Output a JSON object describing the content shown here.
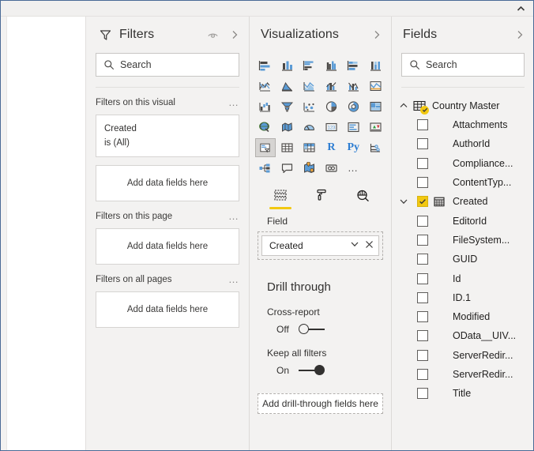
{
  "topbar": {
    "collapse_icon": "chevron-up-icon"
  },
  "filters": {
    "title": "Filters",
    "funnel_icon": "funnel-icon",
    "eye_icon": "eye-icon",
    "expand_icon": "chevron-right-icon",
    "search_placeholder": "Search",
    "search_icon": "search-icon",
    "groups": [
      {
        "title": "Filters on this visual",
        "menu": "…",
        "cards": [
          {
            "field": "Created",
            "condition": "is (All)"
          }
        ],
        "dropzone": "Add data fields here"
      },
      {
        "title": "Filters on this page",
        "menu": "…",
        "cards": [],
        "dropzone": "Add data fields here"
      },
      {
        "title": "Filters on all pages",
        "menu": "…",
        "cards": [],
        "dropzone": "Add data fields here"
      }
    ]
  },
  "visualizations": {
    "title": "Visualizations",
    "expand_icon": "chevron-right-icon",
    "icons": [
      "stacked-bar-chart-icon",
      "stacked-column-chart-icon",
      "clustered-bar-chart-icon",
      "clustered-column-chart-icon",
      "100-stacked-bar-chart-icon",
      "100-stacked-column-chart-icon",
      "line-chart-icon",
      "area-chart-icon",
      "stacked-area-chart-icon",
      "line-stacked-column-chart-icon",
      "line-clustered-column-chart-icon",
      "ribbon-chart-icon",
      "waterfall-chart-icon",
      "funnel-chart-icon",
      "scatter-chart-icon",
      "pie-chart-icon",
      "donut-chart-icon",
      "treemap-icon",
      "map-icon",
      "filled-map-icon",
      "gauge-icon",
      "card-icon",
      "multi-row-card-icon",
      "kpi-icon",
      "slicer-icon",
      "table-icon",
      "matrix-icon",
      "r-script-visual-icon",
      "python-visual-icon",
      "key-influencers-icon",
      "decomposition-tree-icon",
      "q-and-a-icon",
      "arcgis-maps-icon",
      "paginated-report-icon",
      "more-options-icon"
    ],
    "selected_icon": "slicer-icon",
    "r_label": "R",
    "py_label": "Py",
    "more_label": "…",
    "tabs": [
      {
        "label": "Field",
        "icon": "fields-pane-icon",
        "active": true
      },
      {
        "label": "Format",
        "icon": "paint-roller-icon",
        "active": false
      },
      {
        "label": "Analytics",
        "icon": "magnifier-chart-icon",
        "active": false
      }
    ],
    "section_label": "Field",
    "well_chip": {
      "label": "Created",
      "chevron_icon": "chevron-down-icon",
      "remove_icon": "close-icon"
    }
  },
  "drill_through": {
    "title": "Drill through",
    "cross_report": {
      "label": "Cross-report",
      "state": "Off",
      "on": false
    },
    "keep_all_filters": {
      "label": "Keep all filters",
      "state": "On",
      "on": true
    },
    "dropzone": "Add drill-through fields here"
  },
  "fields": {
    "title": "Fields",
    "expand_icon": "chevron-right-icon",
    "search_placeholder": "Search",
    "search_icon": "search-icon",
    "table": {
      "name": "Country Master",
      "icon": "table-icon",
      "badge_icon": "check-icon",
      "collapse_icon": "chevron-up-icon",
      "expanded": true
    },
    "items": [
      {
        "label": "Attachments",
        "checked": false,
        "icon": null,
        "chevron": false
      },
      {
        "label": "AuthorId",
        "checked": false,
        "icon": null,
        "chevron": false
      },
      {
        "label": "Compliance...",
        "checked": false,
        "icon": null,
        "chevron": false
      },
      {
        "label": "ContentTyp...",
        "checked": false,
        "icon": null,
        "chevron": false
      },
      {
        "label": "Created",
        "checked": true,
        "icon": "calendar-icon",
        "chevron": true
      },
      {
        "label": "EditorId",
        "checked": false,
        "icon": null,
        "chevron": false
      },
      {
        "label": "FileSystem...",
        "checked": false,
        "icon": null,
        "chevron": false
      },
      {
        "label": "GUID",
        "checked": false,
        "icon": null,
        "chevron": false
      },
      {
        "label": "Id",
        "checked": false,
        "icon": null,
        "chevron": false
      },
      {
        "label": "ID.1",
        "checked": false,
        "icon": null,
        "chevron": false
      },
      {
        "label": "Modified",
        "checked": false,
        "icon": null,
        "chevron": false
      },
      {
        "label": "OData__UIV...",
        "checked": false,
        "icon": null,
        "chevron": false
      },
      {
        "label": "ServerRedir...",
        "checked": false,
        "icon": null,
        "chevron": false
      },
      {
        "label": "ServerRedir...",
        "checked": false,
        "icon": null,
        "chevron": false
      },
      {
        "label": "Title",
        "checked": false,
        "icon": null,
        "chevron": false
      }
    ]
  },
  "colors": {
    "accent_yellow": "#f2c811",
    "icon_blue": "#2d7dd2",
    "icon_dark": "#4a4846",
    "panel_bg": "#f3f2f1",
    "window_border": "#4a6a96"
  }
}
